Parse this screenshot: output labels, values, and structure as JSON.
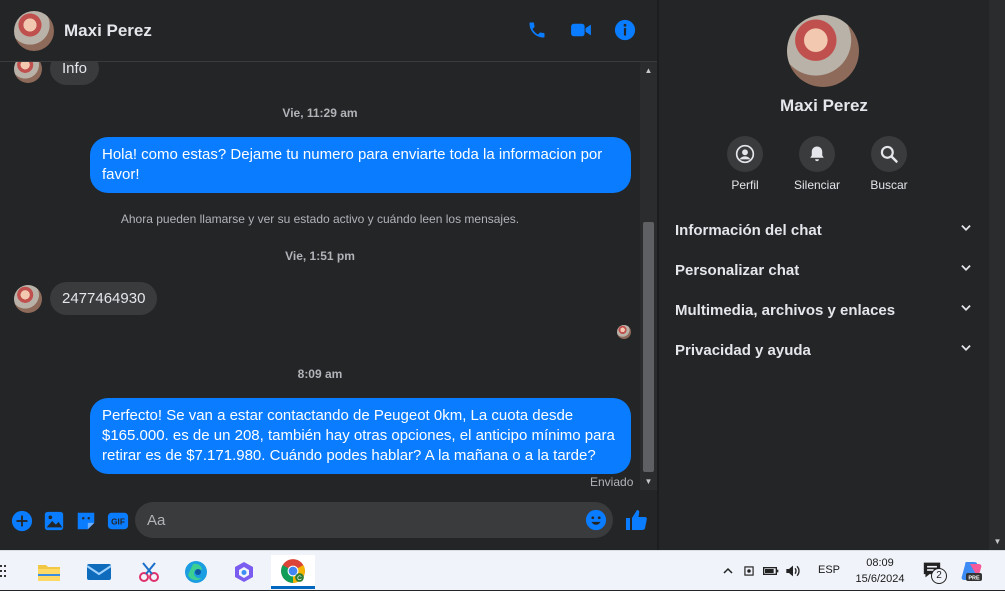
{
  "contact": {
    "name": "Maxi Perez"
  },
  "header": {
    "icons": [
      "phone-icon",
      "video-camera-icon",
      "info-icon"
    ]
  },
  "messages": [
    {
      "type": "incoming",
      "text": "Info"
    },
    {
      "type": "timestamp",
      "text": "Vie, 11:29 am"
    },
    {
      "type": "outgoing",
      "text": "Hola! como estas? Dejame tu numero para enviarte toda la informacion por favor!"
    },
    {
      "type": "system",
      "text": "Ahora pueden llamarse y ver su estado activo y cuándo leen los mensajes."
    },
    {
      "type": "timestamp",
      "text": "Vie, 1:51 pm"
    },
    {
      "type": "incoming",
      "text": "2477464930"
    },
    {
      "type": "timestamp",
      "text": "8:09 am"
    },
    {
      "type": "outgoing",
      "text": "Perfecto!  Se van a estar contactando de Peugeot 0km, La cuota desde $165.000. es de un 208, también hay otras opciones, el anticipo mínimo para retirar es de $7.171.980. Cuándo podes hablar? A la mañana o a la tarde?"
    },
    {
      "type": "status",
      "text": "Enviado"
    }
  ],
  "composer": {
    "placeholder": "Aa",
    "icons": [
      "plus-icon",
      "image-icon",
      "sticker-icon",
      "gif-icon",
      "emoji-icon",
      "thumbs-up-icon"
    ]
  },
  "panel": {
    "name": "Maxi Perez",
    "actions": [
      {
        "label": "Perfil",
        "icon": "profile-icon"
      },
      {
        "label": "Silenciar",
        "icon": "bell-icon"
      },
      {
        "label": "Buscar",
        "icon": "search-icon"
      }
    ],
    "sections": [
      "Información del chat",
      "Personalizar chat",
      "Multimedia, archivos y enlaces",
      "Privacidad y ayuda"
    ]
  },
  "taskbar": {
    "apps": [
      "file-explorer-icon",
      "mail-icon",
      "snipping-tool-icon",
      "edge-icon",
      "copilot-icon",
      "chrome-icon"
    ],
    "language": "ESP",
    "time": "08:09",
    "date": "15/6/2024",
    "notification_count": "2"
  },
  "colors": {
    "bubble_out": "#0a7cff",
    "bubble_in": "#3a3b3c",
    "background": "#242526",
    "accent": "#0a7cff"
  }
}
